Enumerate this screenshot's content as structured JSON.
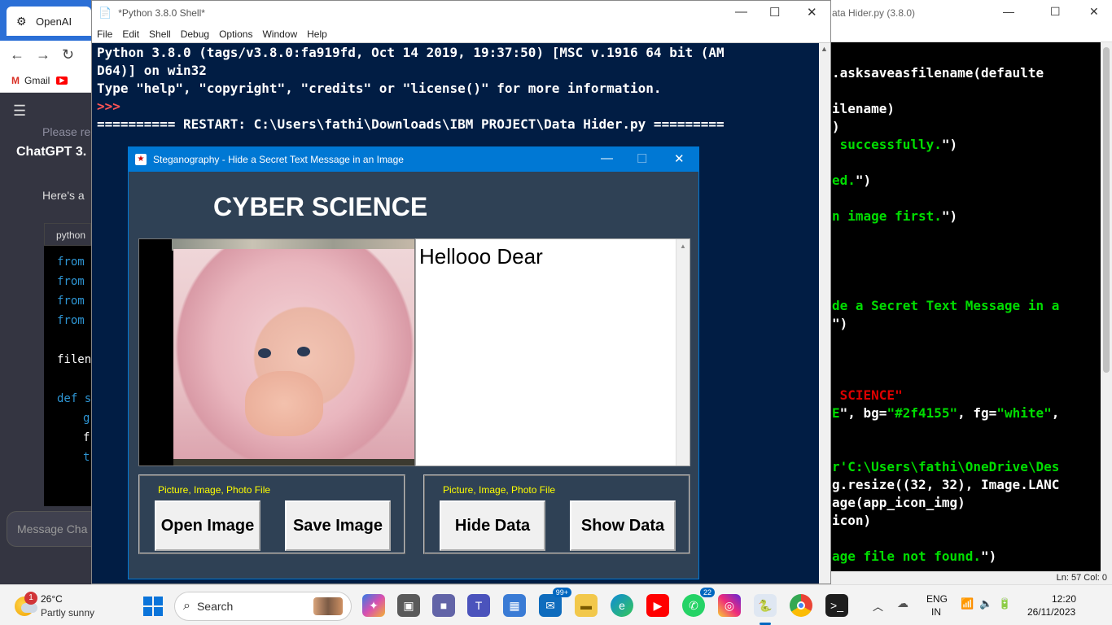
{
  "browser": {
    "tab_title": "OpenAI",
    "bookmark_gmail": "Gmail",
    "notice": "Please re",
    "chat_title": "ChatGPT 3.",
    "heres": "Here's a",
    "code_lang": "python",
    "code_lines": [
      "from",
      "from",
      "from",
      "from",
      "filen",
      "def s",
      "g",
      "f",
      "t"
    ],
    "message_placeholder": "Message Cha"
  },
  "shell": {
    "title": "*Python 3.8.0 Shell*",
    "menu": [
      "File",
      "Edit",
      "Shell",
      "Debug",
      "Options",
      "Window",
      "Help"
    ],
    "lines": [
      "Python 3.8.0 (tags/v3.8.0:fa919fd, Oct 14 2019, 19:37:50) [MSC v.1916 64 bit (AM",
      "D64)] on win32",
      "Type \"help\", \"copyright\", \"credits\" or \"license()\" for more information.",
      "",
      "========== RESTART: C:\\Users\\fathi\\Downloads\\IBM PROJECT\\Data Hider.py ========="
    ],
    "prompt": ">>>"
  },
  "editor": {
    "title": "ata Hider.py (3.8.0)",
    "status": "Ln: 57   Col: 0"
  },
  "app": {
    "title": "Steganography - Hide a Secret Text Message in an Image",
    "heading": "CYBER SCIENCE",
    "text_content": "Hellooo Dear",
    "frame1_label": "Picture, Image, Photo File",
    "frame2_label": "Picture, Image, Photo File",
    "open_image": "Open Image",
    "save_image": "Save Image",
    "hide_data": "Hide Data",
    "show_data": "Show Data",
    "bg_color": "#2f4155"
  },
  "taskbar": {
    "weather_temp": "26°C",
    "weather_cond": "Partly sunny",
    "weather_badge": "1",
    "search_label": "Search",
    "mail_badge": "99+",
    "whatsapp_badge": "22",
    "lang_top": "ENG",
    "lang_bottom": "IN",
    "time": "12:20",
    "date": "26/11/2023"
  }
}
